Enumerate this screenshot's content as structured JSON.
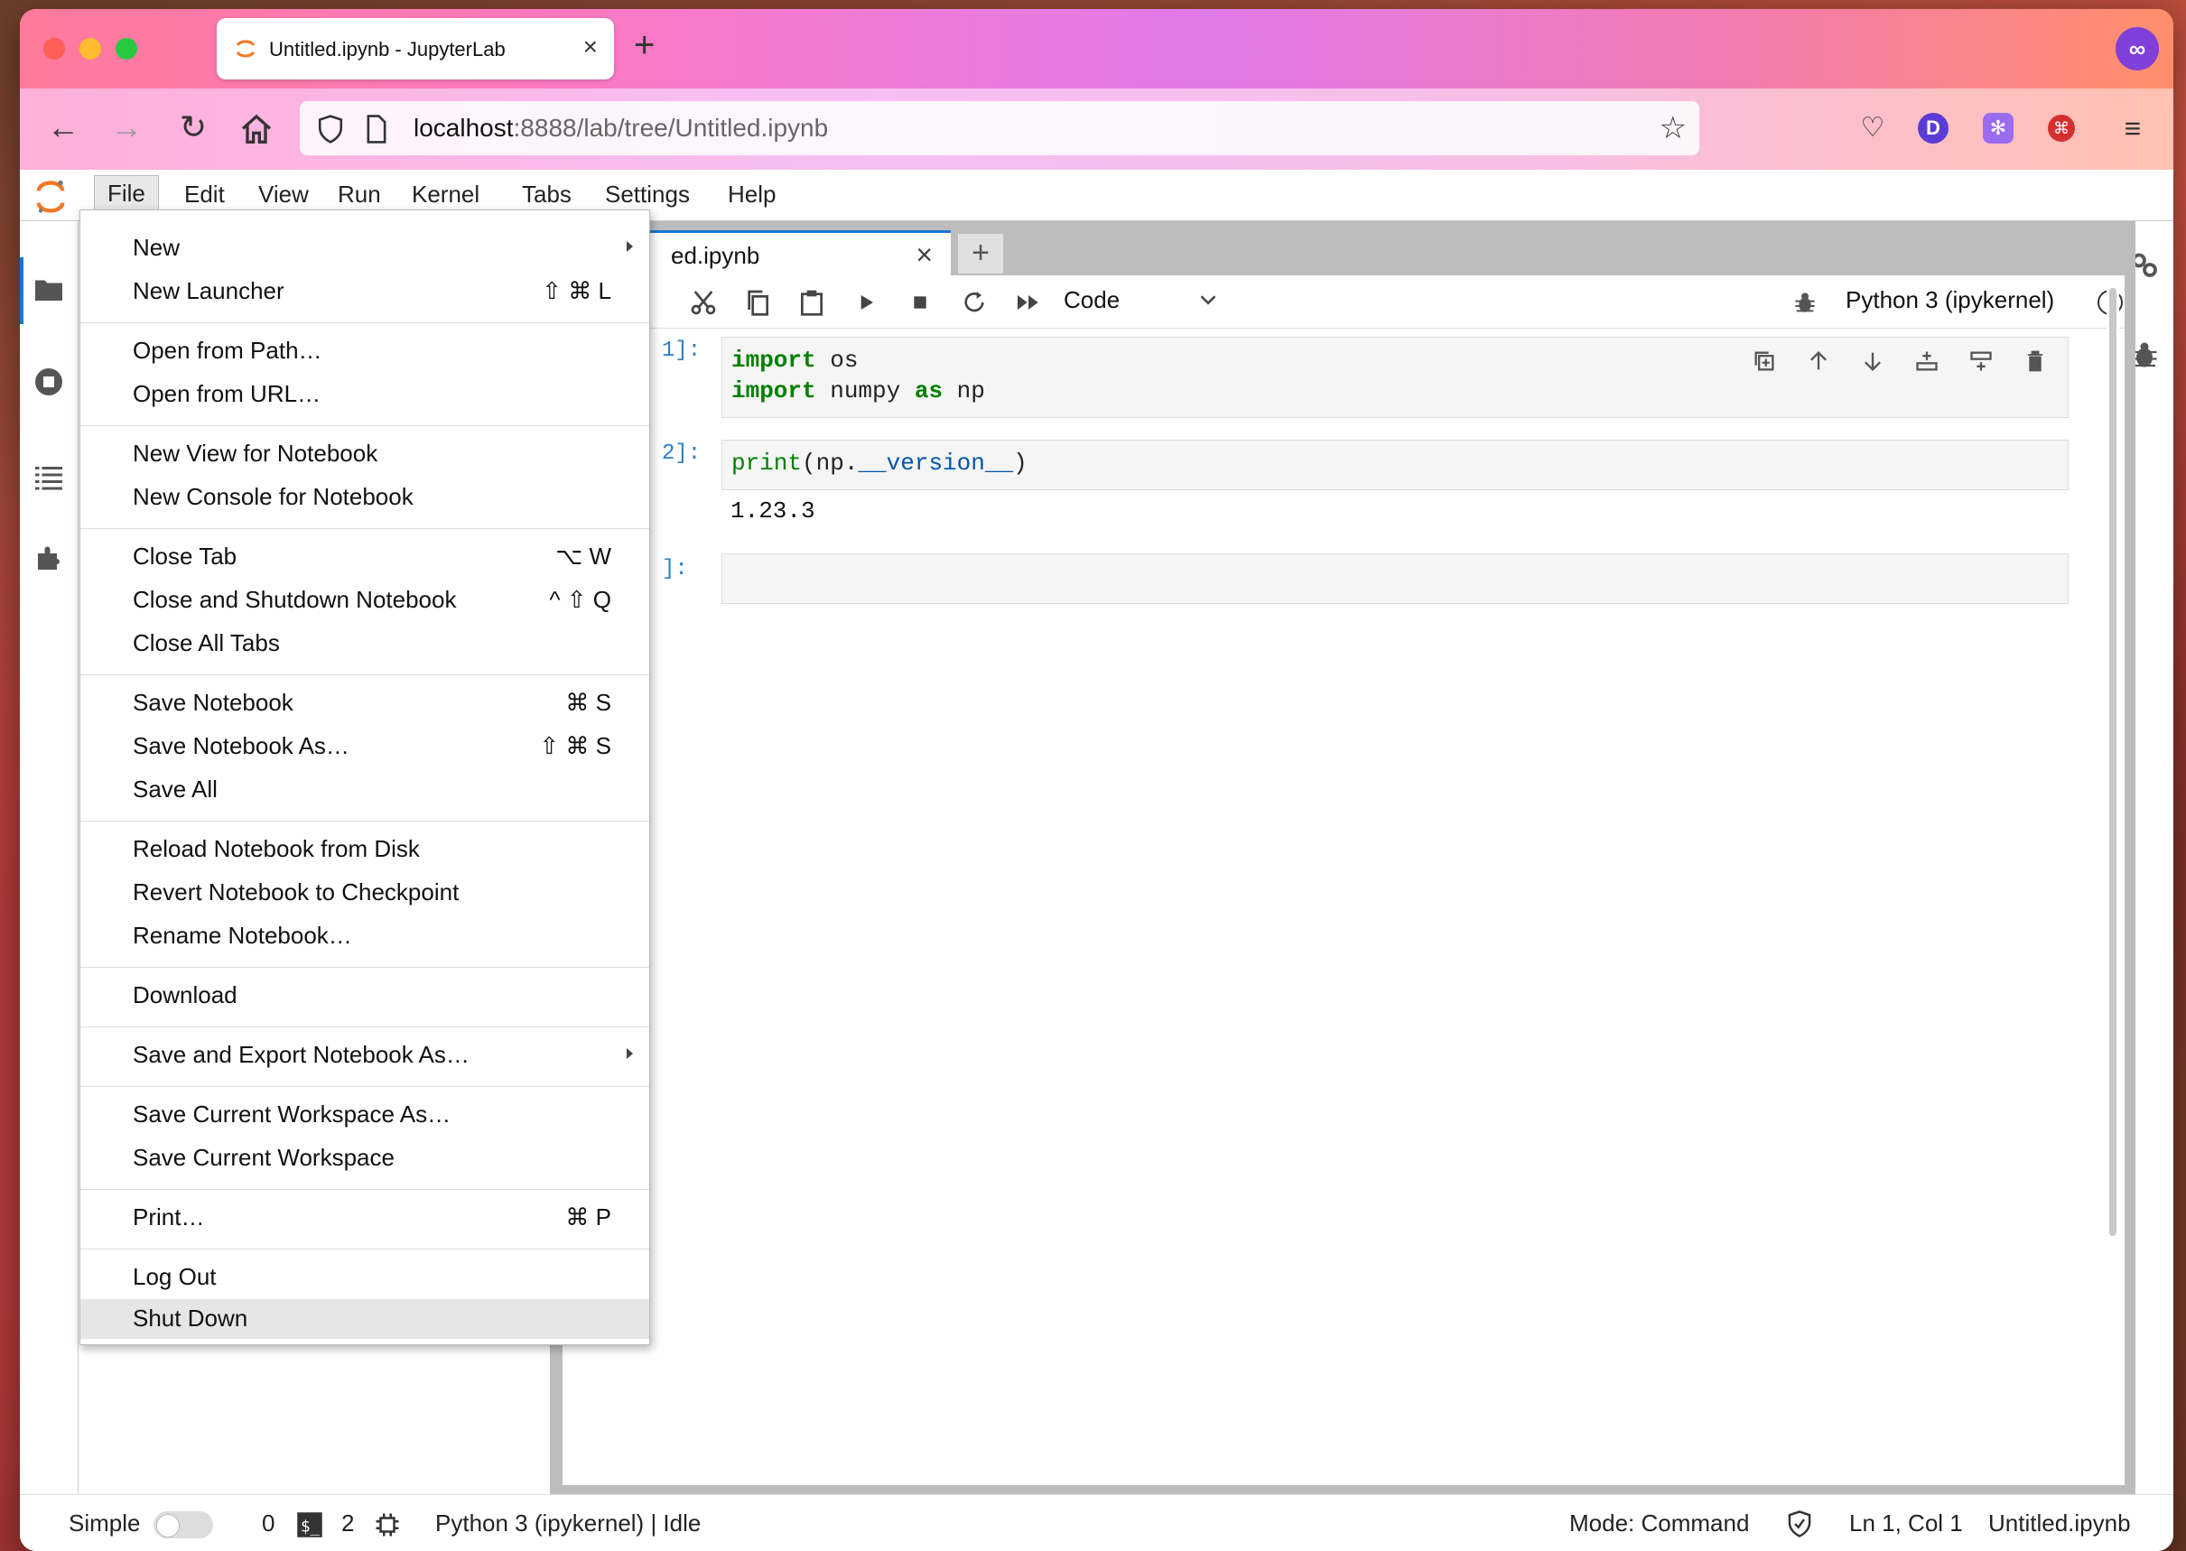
{
  "browser": {
    "tab_title": "Untitled.ipynb - JupyterLab",
    "url_host": "localhost",
    "url_rest": ":8888/lab/tree/Untitled.ipynb",
    "profile_initial": "D"
  },
  "menubar": {
    "items": [
      "File",
      "Edit",
      "View",
      "Run",
      "Kernel",
      "Tabs",
      "Settings",
      "Help"
    ]
  },
  "file_menu": {
    "items": [
      {
        "label": "New",
        "shortcut": ""
      },
      {
        "label": "New Launcher",
        "shortcut": "⇧ ⌘ L"
      },
      {
        "label": "Open from Path…",
        "shortcut": ""
      },
      {
        "label": "Open from URL…",
        "shortcut": ""
      },
      {
        "label": "New View for Notebook",
        "shortcut": ""
      },
      {
        "label": "New Console for Notebook",
        "shortcut": ""
      },
      {
        "label": "Close Tab",
        "shortcut": "⌥ W"
      },
      {
        "label": "Close and Shutdown Notebook",
        "shortcut": "^ ⇧ Q"
      },
      {
        "label": "Close All Tabs",
        "shortcut": ""
      },
      {
        "label": "Save Notebook",
        "shortcut": "⌘ S"
      },
      {
        "label": "Save Notebook As…",
        "shortcut": "⇧ ⌘ S"
      },
      {
        "label": "Save All",
        "shortcut": ""
      },
      {
        "label": "Reload Notebook from Disk",
        "shortcut": ""
      },
      {
        "label": "Revert Notebook to Checkpoint",
        "shortcut": ""
      },
      {
        "label": "Rename Notebook…",
        "shortcut": ""
      },
      {
        "label": "Download",
        "shortcut": ""
      },
      {
        "label": "Save and Export Notebook As…",
        "shortcut": ""
      },
      {
        "label": "Save Current Workspace As…",
        "shortcut": ""
      },
      {
        "label": "Save Current Workspace",
        "shortcut": ""
      },
      {
        "label": "Print…",
        "shortcut": "⌘ P"
      },
      {
        "label": "Log Out",
        "shortcut": ""
      },
      {
        "label": "Shut Down",
        "shortcut": ""
      }
    ]
  },
  "notebook": {
    "tab_name": "ed.ipynb",
    "cell_type": "Code",
    "kernel": "Python 3 (ipykernel)",
    "cells": [
      {
        "prompt": "1]:",
        "line1_kw": "import",
        "line1_rest": " os",
        "line2_kw": "import",
        "line2_mid": " numpy ",
        "line2_kw2": "as",
        "line2_rest": " np"
      },
      {
        "prompt": "2]:",
        "fn": "print",
        "open": "(np.",
        "attr": "__version__",
        "close": ")",
        "output": "1.23.3"
      },
      {
        "prompt": "]:"
      }
    ]
  },
  "statusbar": {
    "simple": "Simple",
    "terminals": "0",
    "kernels": "2",
    "kernel_status": "Python 3 (ipykernel) | Idle",
    "mode": "Mode: Command",
    "position": "Ln 1, Col 1",
    "filename": "Untitled.ipynb"
  }
}
